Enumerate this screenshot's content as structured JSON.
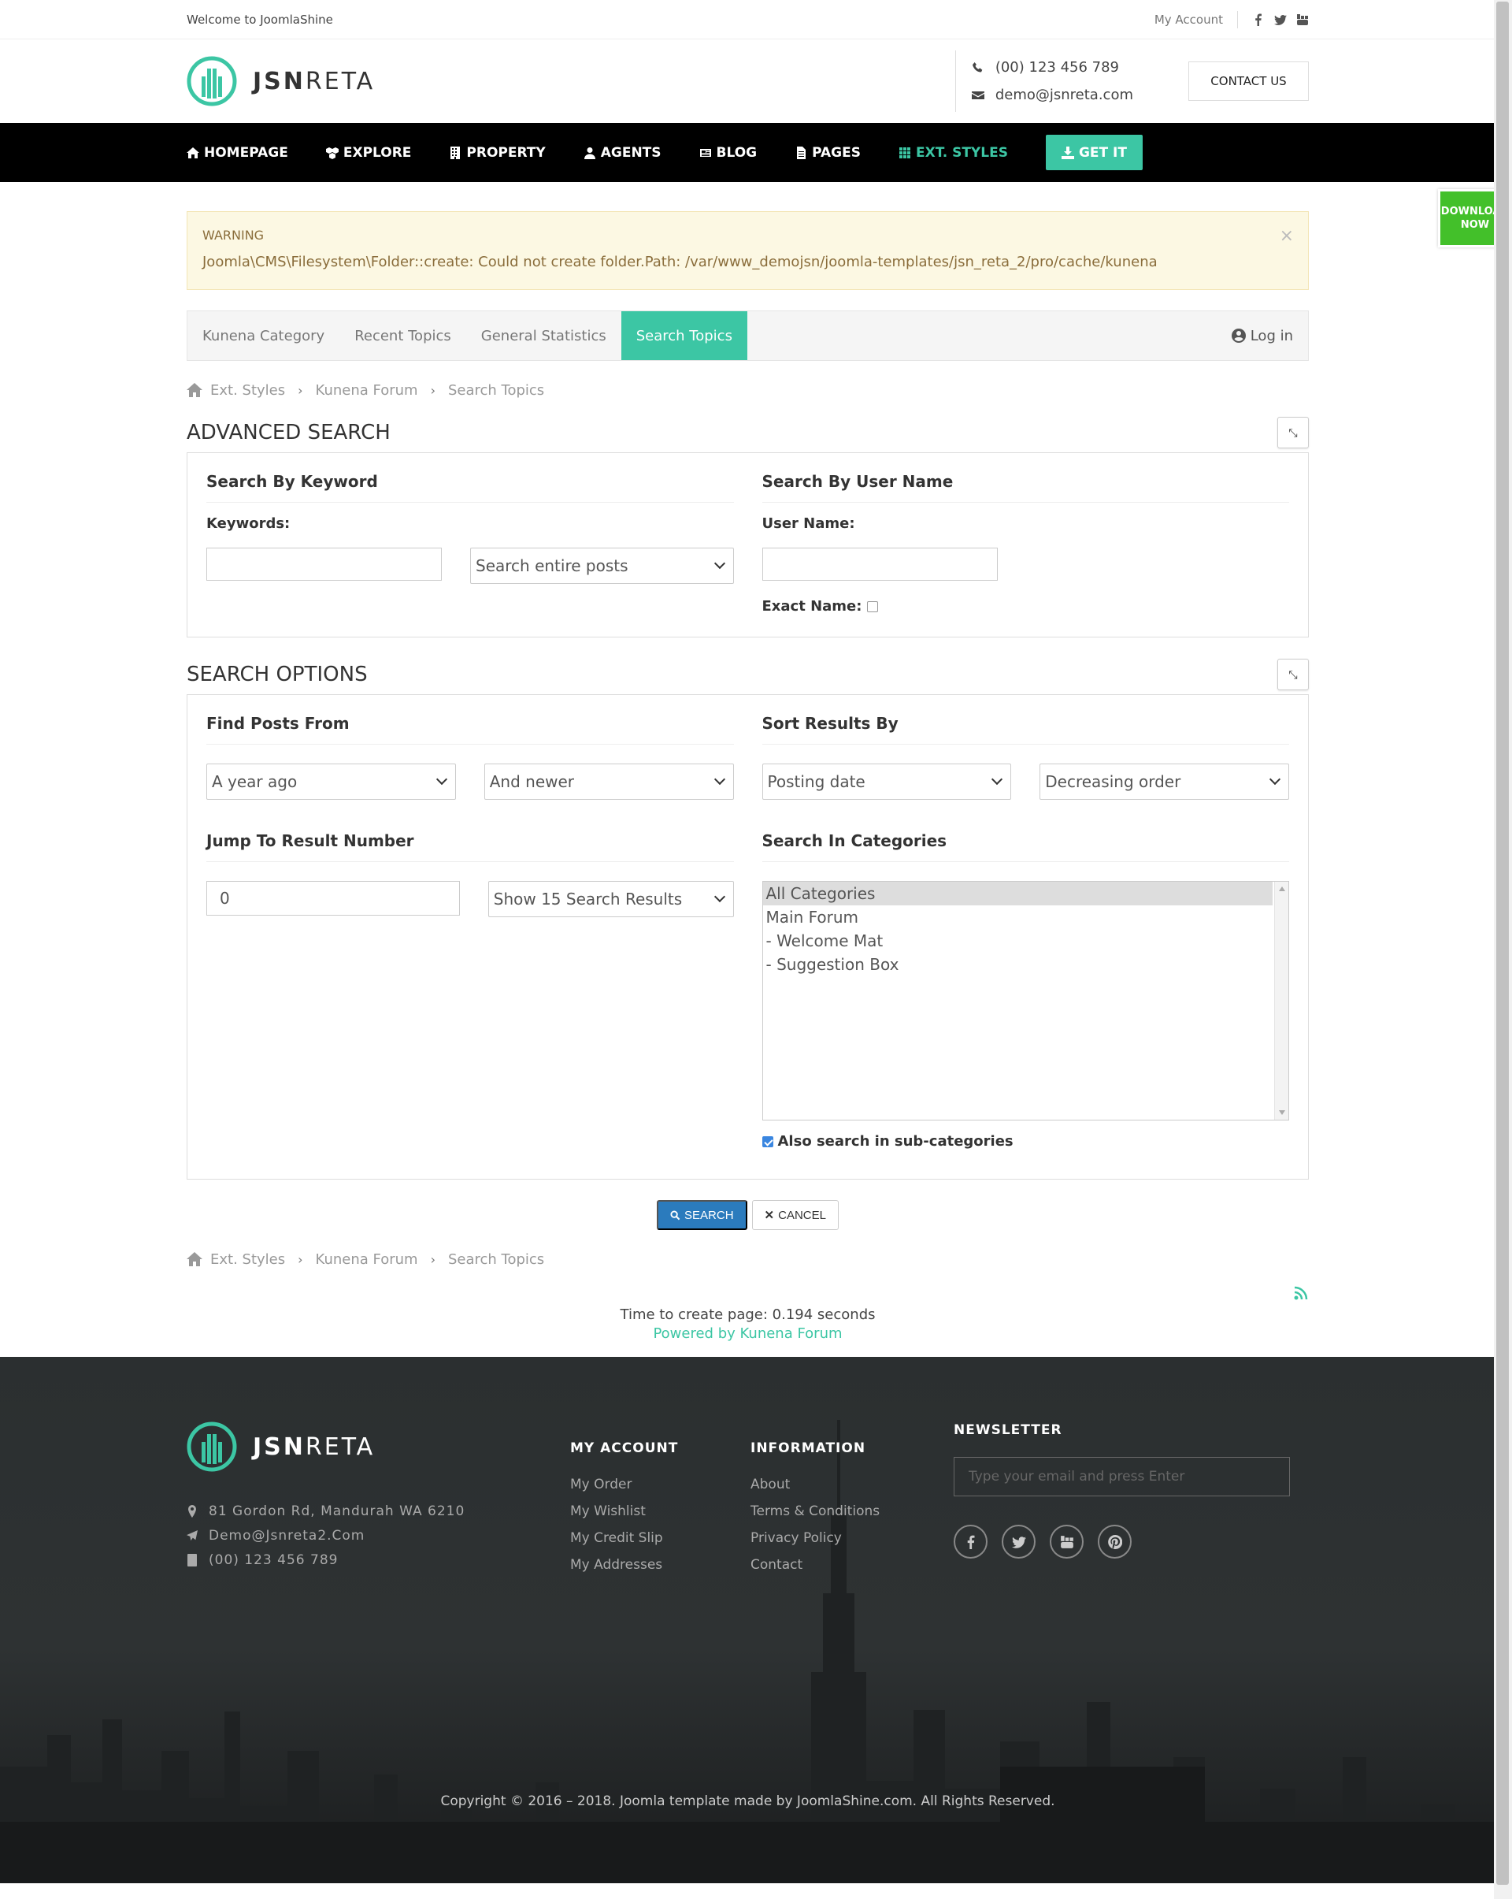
{
  "topbar": {
    "welcome": "Welcome to JoomlaShine",
    "my_account": "My Account",
    "social": [
      "facebook-icon",
      "twitter-icon",
      "youtube-icon"
    ]
  },
  "header": {
    "logo_bold": "JSN",
    "logo_light": "RETA",
    "phone": "(00) 123 456 789",
    "email": "demo@jsnreta.com",
    "contact_button": "CONTACT US"
  },
  "nav": {
    "items": [
      {
        "label": "HOMEPAGE",
        "icon": "home-icon"
      },
      {
        "label": "EXPLORE",
        "icon": "cubes-icon"
      },
      {
        "label": "PROPERTY",
        "icon": "building-icon"
      },
      {
        "label": "AGENTS",
        "icon": "user-icon"
      },
      {
        "label": "BLOG",
        "icon": "newspaper-icon"
      },
      {
        "label": "PAGES",
        "icon": "file-icon"
      },
      {
        "label": "EXT. STYLES",
        "icon": "grid-icon"
      }
    ],
    "get_it": "GET IT"
  },
  "download_tab": {
    "line1": "DOWNLOAD",
    "line2": "NOW"
  },
  "warning": {
    "title": "WARNING",
    "message": "Joomla\\CMS\\Filesystem\\Folder::create: Could not create folder.Path: /var/www_demojsn/joomla-templates/jsn_reta_2/pro/cache/kunena"
  },
  "tabs": {
    "items": [
      "Kunena Category",
      "Recent Topics",
      "General Statistics",
      "Search Topics"
    ],
    "active_index": 3,
    "login": "Log in"
  },
  "breadcrumb": [
    "Ext. Styles",
    "Kunena Forum",
    "Search Topics"
  ],
  "advanced_search": {
    "title": "ADVANCED SEARCH",
    "keyword_heading": "Search By Keyword",
    "keywords_label": "Keywords:",
    "keywords_value": "",
    "keyword_scope": "Search entire posts",
    "user_heading": "Search By User Name",
    "user_label": "User Name:",
    "user_value": "",
    "exact_name_label": "Exact Name:",
    "exact_name_checked": false
  },
  "search_options": {
    "title": "SEARCH OPTIONS",
    "find_posts_heading": "Find Posts From",
    "from_value": "A year ago",
    "from_direction": "And newer",
    "sort_heading": "Sort Results By",
    "sort_field": "Posting date",
    "sort_order": "Decreasing order",
    "jump_heading": "Jump To Result Number",
    "jump_value": "0",
    "show_results": "Show 15 Search Results",
    "categories_heading": "Search In Categories",
    "categories": [
      "All Categories",
      "Main Forum",
      "- Welcome Mat",
      "- Suggestion Box"
    ],
    "selected_category": "All Categories",
    "subcat_label": "Also search in sub-categories",
    "subcat_checked": true
  },
  "buttons": {
    "search": "SEARCH",
    "cancel": "CANCEL"
  },
  "stats": {
    "time": "Time to create page: 0.194 seconds",
    "powered": "Powered by Kunena Forum"
  },
  "footer": {
    "address": "81 Gordon Rd, Mandurah WA 6210",
    "email": "Demo@Jsnreta2.Com",
    "phone": "(00) 123 456 789",
    "my_account_heading": "MY ACCOUNT",
    "my_account_links": [
      "My Order",
      "My Wishlist",
      "My Credit Slip",
      "My Addresses"
    ],
    "information_heading": "INFORMATION",
    "information_links": [
      "About",
      "Terms & Conditions",
      "Privacy Policy",
      "Contact"
    ],
    "newsletter_heading": "NEWSLETTER",
    "newsletter_placeholder": "Type your email and press Enter",
    "social": [
      "facebook-icon",
      "twitter-icon",
      "youtube-icon",
      "pinterest-icon"
    ],
    "copyright": "Copyright © 2016 – 2018. Joomla template made by JoomlaShine.com. All Rights Reserved."
  },
  "colors": {
    "accent": "#3cc6a4",
    "download": "#43c02a",
    "primary_button": "#2b7bbd"
  }
}
